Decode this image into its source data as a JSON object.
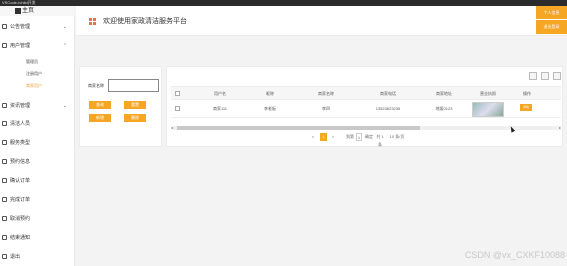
{
  "window": {
    "title": "VSCode-Ichild开发"
  },
  "sidebar": {
    "brand": "主页",
    "items": [
      {
        "label": "公告管理",
        "icon": "bell-icon",
        "expanded": false
      },
      {
        "label": "用户管理",
        "icon": "user-icon",
        "expanded": true
      },
      {
        "label": "资讯管理",
        "icon": "news-icon",
        "expanded": false
      },
      {
        "label": "清洁人员",
        "icon": "person-icon"
      },
      {
        "label": "服务类型",
        "icon": "tag-icon"
      },
      {
        "label": "预约信息",
        "icon": "calendar-icon"
      },
      {
        "label": "确认订单",
        "icon": "check-icon"
      },
      {
        "label": "完成订单",
        "icon": "doc-icon"
      },
      {
        "label": "取消预约",
        "icon": "cancel-icon"
      },
      {
        "label": "结束通知",
        "icon": "notice-icon"
      },
      {
        "label": "退出",
        "icon": "logout-icon"
      }
    ],
    "sub_items": [
      "管理员",
      "注册用户",
      "商家用户"
    ]
  },
  "topbar": {
    "title": "欢迎使用家政清洁服务平台",
    "user_button": "个人信息",
    "exit_button": "退出登录"
  },
  "search": {
    "label": "商家名称",
    "value": "",
    "buttons": [
      "查询",
      "重置",
      "新增",
      "删除"
    ]
  },
  "table": {
    "columns": [
      "用户名",
      "昵称",
      "商家名称",
      "商家电话",
      "商家地址",
      "营业执照",
      "操作"
    ],
    "rows": [
      {
        "username": "商家111",
        "nickname": "李老板",
        "shop_name": "李四",
        "phone": "13523623235",
        "address": "地坂0123",
        "op": "详情"
      }
    ]
  },
  "pager": {
    "prev": "<",
    "current": "1",
    "next": ">",
    "goto": "到第",
    "page_input": "1",
    "confirm": "确定",
    "total": "共 1 条",
    "page_size": "10 条/页"
  },
  "watermark": "CSDN @vx_CXKF10088",
  "colors": {
    "accent": "#f5a623",
    "logo": "#e6704b"
  }
}
